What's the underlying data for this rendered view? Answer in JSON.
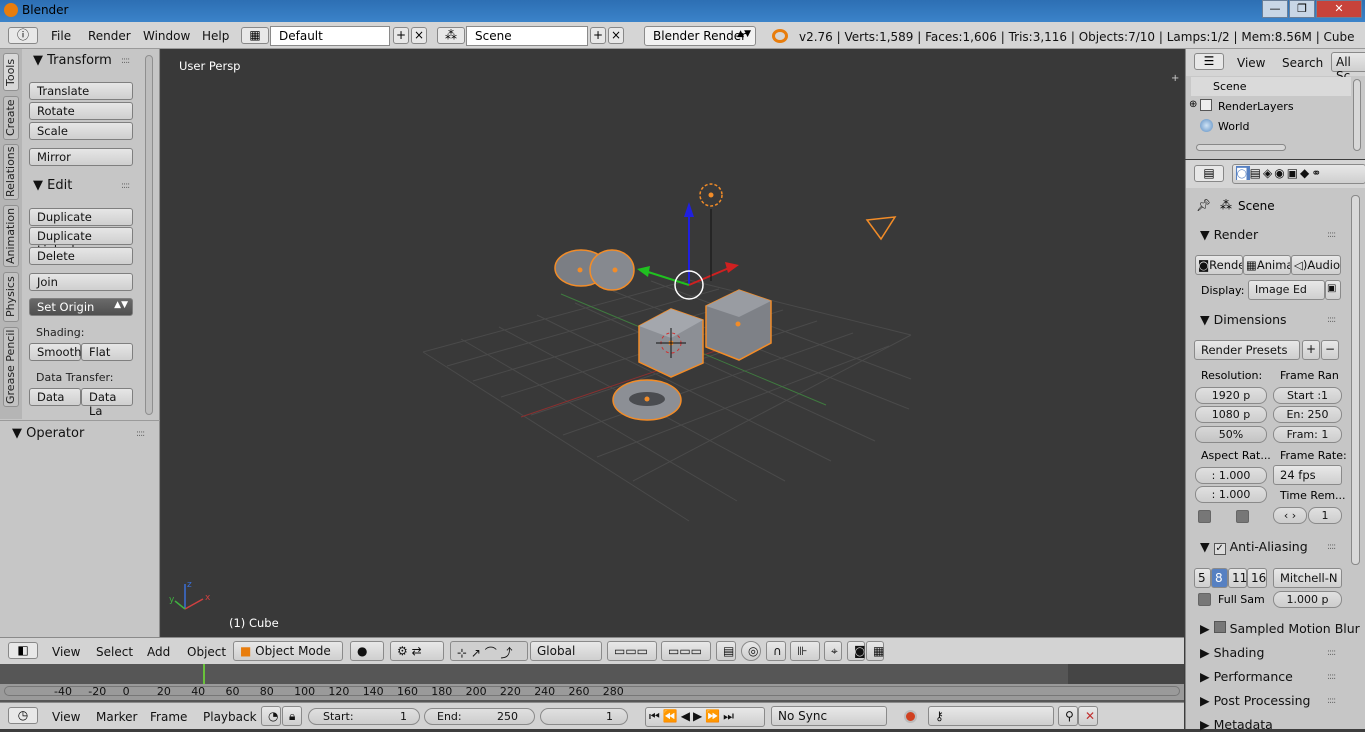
{
  "window": {
    "title": "Blender",
    "minimize": "—",
    "maximize": "❐",
    "close": "✕"
  },
  "info_header": {
    "menus": [
      "File",
      "Render",
      "Window",
      "Help"
    ],
    "layout": "Default",
    "scene": "Scene",
    "engine": "Blender Render",
    "stats": "v2.76 | Verts:1,589 | Faces:1,606 | Tris:3,116 | Objects:7/10 | Lamps:1/2 | Mem:8.56M | Cube"
  },
  "tool_tabs": [
    "Tools",
    "Create",
    "Relations",
    "Animation",
    "Physics",
    "Grease Pencil"
  ],
  "tool_shelf": {
    "transform_title": "Transform",
    "transform_buttons": [
      "Translate",
      "Rotate",
      "Scale"
    ],
    "mirror": "Mirror",
    "edit_title": "Edit",
    "edit_buttons": [
      "Duplicate",
      "Duplicate Linked",
      "Delete"
    ],
    "join": "Join",
    "set_origin": "Set Origin",
    "shading_label": "Shading:",
    "smooth": "Smooth",
    "flat": "Flat",
    "data_transfer_label": "Data Transfer:",
    "data": "Data",
    "data_layers": "Data La",
    "operator_title": "Operator"
  },
  "viewport": {
    "view_name": "User Persp",
    "object_label": "(1) Cube"
  },
  "viewport_header": {
    "menus": [
      "View",
      "Select",
      "Add",
      "Object"
    ],
    "mode": "Object Mode",
    "orientation": "Global"
  },
  "timeline": {
    "ruler": [
      "-40",
      "-20",
      "0",
      "20",
      "40",
      "60",
      "80",
      "100",
      "120",
      "140",
      "160",
      "180",
      "200",
      "220",
      "240",
      "260",
      "280"
    ],
    "current_frame_marker": 0,
    "menus": [
      "View",
      "Marker",
      "Frame",
      "Playback"
    ],
    "start_label": "Start:",
    "start_value": "1",
    "end_label": "End:",
    "end_value": "250",
    "current_frame": "1",
    "sync": "No Sync"
  },
  "outliner": {
    "menus": [
      "View",
      "Search"
    ],
    "filter": "All Sc",
    "items": [
      "Scene",
      "RenderLayers",
      "World"
    ]
  },
  "properties": {
    "breadcrumb": "Scene",
    "render_section": "Render",
    "render_buttons": [
      "Rende",
      "Anima",
      "Audio"
    ],
    "display_label": "Display:",
    "display_value": "Image Ed",
    "dimensions_section": "Dimensions",
    "render_presets": "Render Presets",
    "resolution_label": "Resolution:",
    "res_x": "1920 p",
    "res_y": "1080 p",
    "res_pct": "50%",
    "frame_range_label": "Frame Ran",
    "frame_start": "Start :1",
    "frame_end": "En: 250",
    "frame_step": "Fram: 1",
    "aspect_label": "Aspect Rat...",
    "aspect_x": ": 1.000",
    "aspect_y": ": 1.000",
    "frame_rate_label": "Frame Rate:",
    "frame_rate": "24 fps",
    "time_remap_label": "Time Rem...",
    "time_remap_value": "1",
    "aa_section": "Anti-Aliasing",
    "aa_samples": [
      "5",
      "8",
      "11",
      "16"
    ],
    "aa_filter": "Mitchell-N",
    "full_sample": "Full Sam",
    "filter_size": "1.000 p",
    "collapsed_sections": [
      "Sampled Motion Blur",
      "Shading",
      "Performance",
      "Post Processing",
      "Metadata"
    ]
  },
  "colors": {
    "accent": "#5680c2",
    "selection": "#f28c28",
    "titlebar": "#3b83c9"
  }
}
